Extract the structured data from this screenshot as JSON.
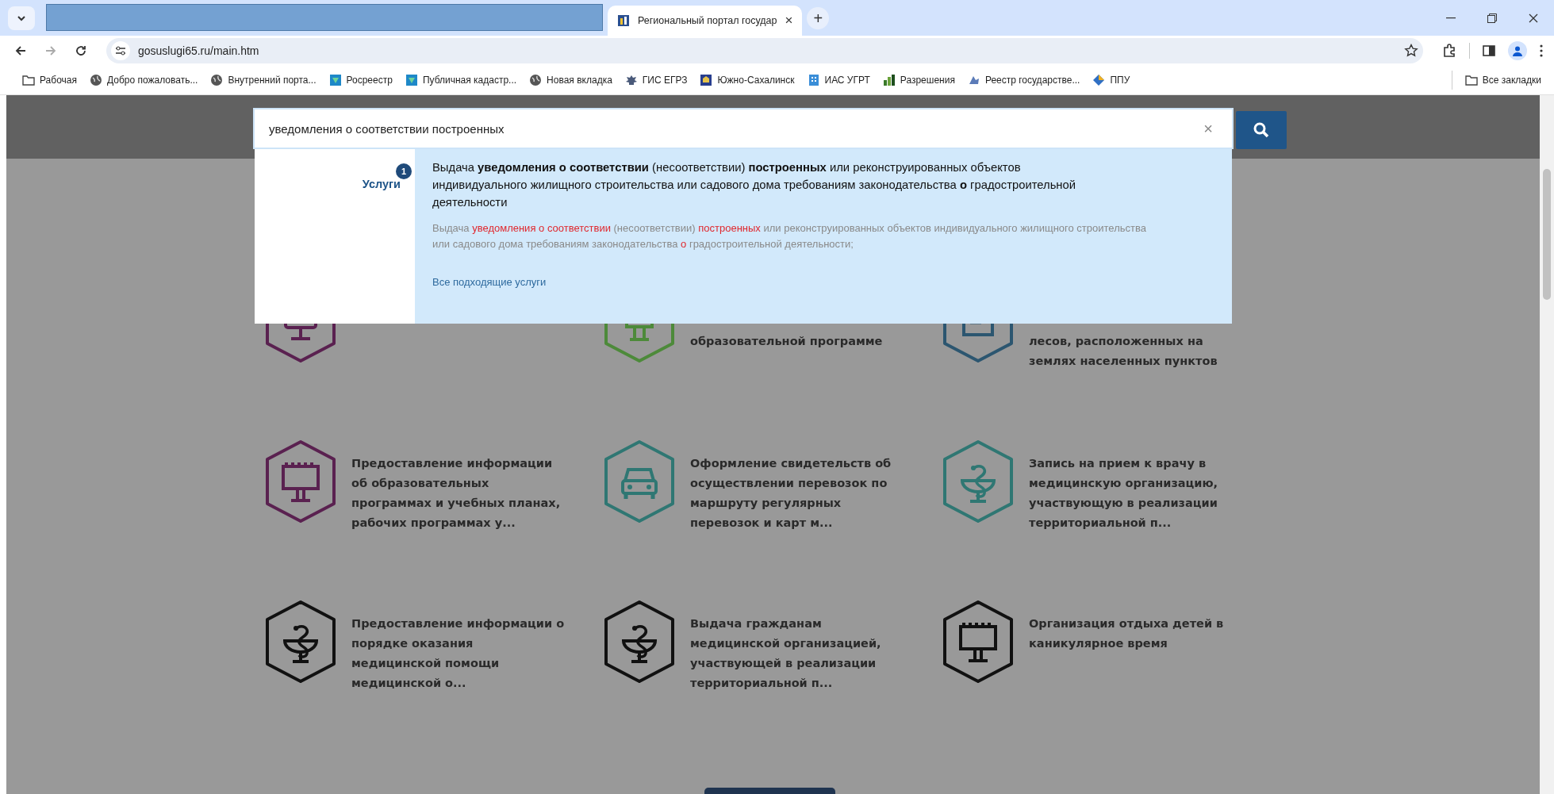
{
  "browser": {
    "tabs": [
      {
        "kind": "redacted",
        "selected": false
      },
      {
        "kind": "page",
        "title": "Региональный портал государ",
        "close": "×",
        "selected": true
      }
    ],
    "new_tab": "+",
    "address": "gosuslugi65.ru/main.htm",
    "bookmarks": [
      {
        "kind": "folder",
        "label": "Рабочая"
      },
      {
        "kind": "globe",
        "label": "Добро пожаловать..."
      },
      {
        "kind": "globe",
        "label": "Внутренний порта..."
      },
      {
        "kind": "shield",
        "label": "Росреестр"
      },
      {
        "kind": "shield",
        "label": "Публичная кадастр..."
      },
      {
        "kind": "globe",
        "label": "Новая вкладка"
      },
      {
        "kind": "emblem",
        "label": "ГИС ЕГРЗ"
      },
      {
        "kind": "crest",
        "label": "Южно-Сахалинск"
      },
      {
        "kind": "building",
        "label": "ИАС УГРТ"
      },
      {
        "kind": "chart",
        "label": "Разрешения"
      },
      {
        "kind": "emblem2",
        "label": "Реестр государстве..."
      },
      {
        "kind": "diamond",
        "label": "ППУ"
      }
    ],
    "all_bookmarks": "Все закладки"
  },
  "search": {
    "value": "уведомления о соответствии построенных",
    "clear": "×",
    "dropdown": {
      "category": "Услуги",
      "count": "1",
      "result_title": "Выдача **уведомления о соответствии** (несоответствии) **построенных** или реконструированных объектов индивидуального жилищного строительства или садового дома требованиям законодательства **о** градостроительной деятельности",
      "result_description": [
        {
          "text": "Выдача ",
          "highlight": false
        },
        {
          "text": "уведомления о соответствии",
          "highlight": true
        },
        {
          "text": " (несоответствии) ",
          "highlight": false
        },
        {
          "text": "построенных",
          "highlight": true
        },
        {
          "text": " или реконструированных объектов индивидуального жилищного строительства или садового дома требованиям законодательства ",
          "highlight": false
        },
        {
          "text": "о",
          "highlight": true
        },
        {
          "text": " градостроительной деятельности;",
          "highlight": false
        }
      ],
      "all_link": "Все подходящие услуги"
    }
  },
  "services": [
    {
      "kind": "monitor",
      "color": "#5a2150"
    },
    {
      "kind": "certificate",
      "color": "#4d8a3a",
      "title": "образовательной программе"
    },
    {
      "kind": "document",
      "color": "#2c5670",
      "title": "лесов, расположенных на землях населенных пунктов"
    },
    {
      "kind": "billboard",
      "color": "#5a2150",
      "title": "Предоставление информации об образовательных программах и учебных планах, рабочих программах у..."
    },
    {
      "kind": "car",
      "color": "#2f7773",
      "title": "Оформление свидетельств об осуществлении перевозок по маршруту регулярных перевозок и карт м..."
    },
    {
      "kind": "medical",
      "color": "#2f7773",
      "title": "Запись на прием к врачу в медицинскую организацию, участвующую в реализации территориальной п..."
    },
    {
      "kind": "medical",
      "color": "#111111",
      "title": "Предоставление информации о порядке оказания медицинской помощи медицинской о..."
    },
    {
      "kind": "medical",
      "color": "#111111",
      "title": "Выдача гражданам медицинской организацией, участвующей в реализации территориальной п..."
    },
    {
      "kind": "billboard",
      "color": "#111111",
      "title": "Организация отдыха детей в каникулярное время"
    }
  ]
}
